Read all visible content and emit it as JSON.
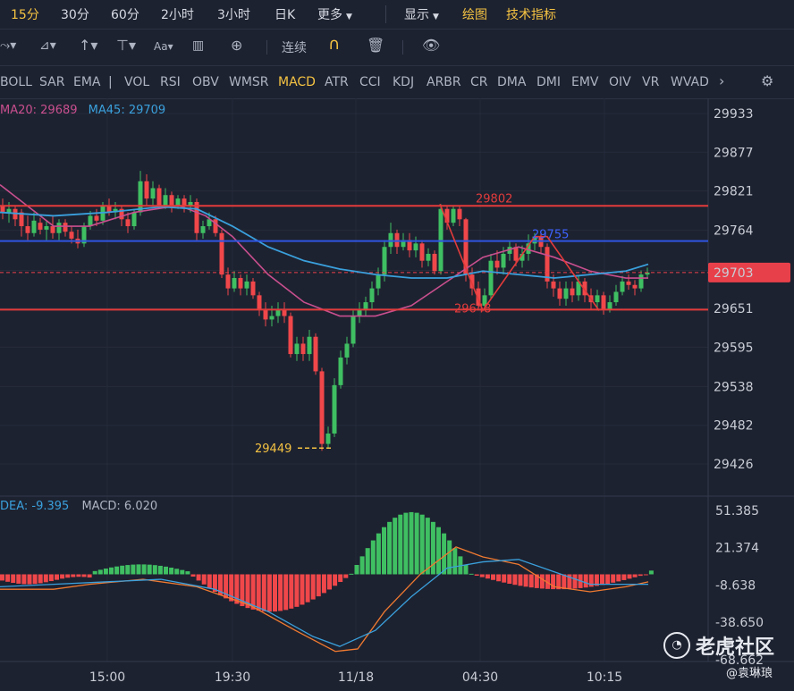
{
  "toolbar": {
    "periods": [
      "15分",
      "30分",
      "60分",
      "2小时",
      "3小时",
      "日K",
      "更多"
    ],
    "active_period": "15分",
    "display_label": "显示",
    "draw_label": "绘图",
    "indicator_label": "技术指标"
  },
  "drawing_toolbar": {
    "continuous_label": "连续",
    "text_tool": "Aa"
  },
  "indicators": {
    "items": [
      "BOLL",
      "SAR",
      "EMA",
      "VOL",
      "RSI",
      "OBV",
      "WMSR",
      "MACD",
      "ATR",
      "CCI",
      "KDJ",
      "ARBR",
      "CR",
      "DMA",
      "DMI",
      "EMV",
      "OIV",
      "VR",
      "WVAD"
    ],
    "active": "MACD",
    "divider": "|"
  },
  "main_legend": {
    "ma20": "MA20: 29689",
    "ma45": "MA45: 29709",
    "ma20_color": "#c94f8f",
    "ma45_color": "#3aa0dc"
  },
  "sub_legend": {
    "dea": "DEA: -9.395",
    "macd": "MACD: 6.020",
    "dea_color": "#3aa0dc",
    "macd_color": "#aeb4c2"
  },
  "price_axis": [
    "29933",
    "29877",
    "29821",
    "29764",
    "29706",
    "29651",
    "29595",
    "29538",
    "29482",
    "29426"
  ],
  "current_price": "29703",
  "macd_axis": [
    "51.385",
    "21.374",
    "-8.638",
    "-38.650",
    "-68.662"
  ],
  "time_axis": [
    "15:00",
    "19:30",
    "11/18",
    "04:30",
    "10:15"
  ],
  "annotations": {
    "high": "29802",
    "mid": "29755",
    "low_mid": "29648",
    "low": "29449"
  },
  "watermark": {
    "brand": "老虎社区",
    "user": "@袁琳琅"
  },
  "colors": {
    "up": "#3fbf62",
    "down": "#f0474a",
    "red_line": "#e33b3b",
    "blue_line": "#2f55e0",
    "accent": "#f5c342"
  }
}
